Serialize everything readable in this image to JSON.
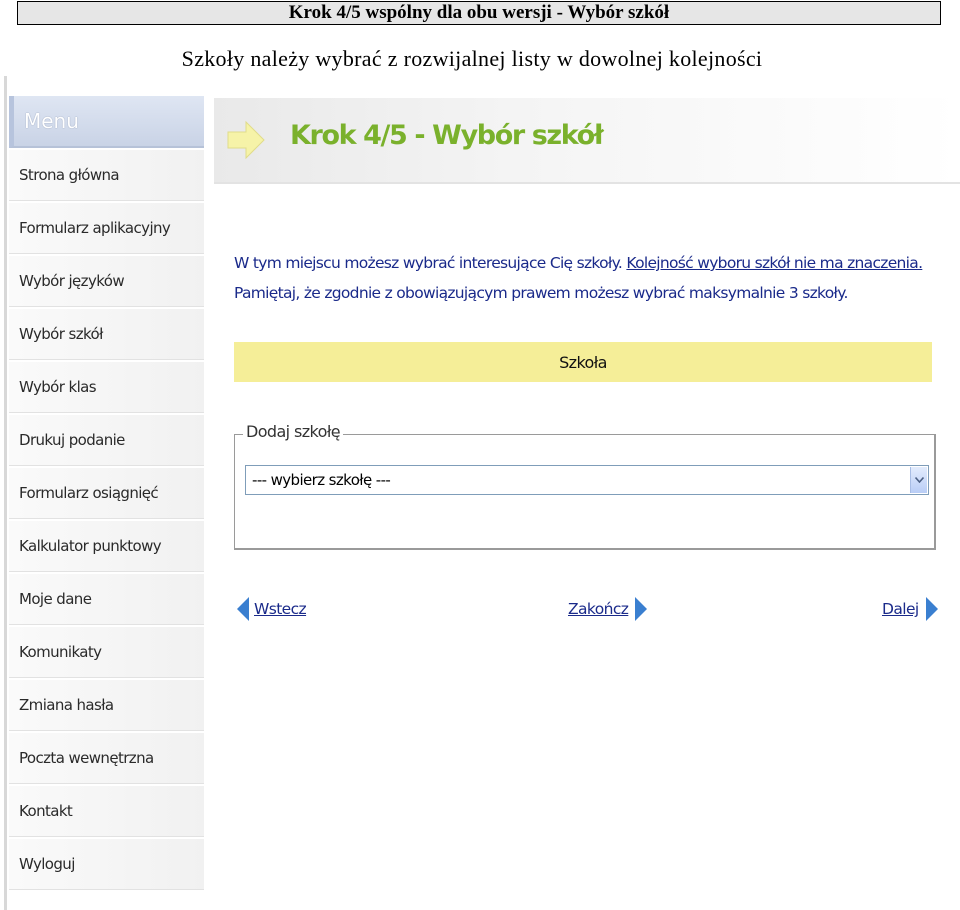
{
  "document": {
    "title": "Krok 4/5 wspólny dla obu wersji - Wybór szkół",
    "subtitle": "Szkoły należy wybrać z rozwijalnej listy w dowolnej kolejności"
  },
  "sidebar": {
    "header": "Menu",
    "items": [
      {
        "label": "Strona główna"
      },
      {
        "label": "Formularz aplikacyjny"
      },
      {
        "label": "Wybór języków"
      },
      {
        "label": "Wybór szkół"
      },
      {
        "label": "Wybór klas"
      },
      {
        "label": "Drukuj podanie"
      },
      {
        "label": "Formularz osiągnięć"
      },
      {
        "label": "Kalkulator punktowy"
      },
      {
        "label": "Moje dane"
      },
      {
        "label": "Komunikaty"
      },
      {
        "label": "Zmiana hasła"
      },
      {
        "label": "Poczta wewnętrzna"
      },
      {
        "label": "Kontakt"
      },
      {
        "label": "Wyloguj"
      }
    ]
  },
  "main": {
    "step_title": "Krok 4/5 - Wybór szkół",
    "info_line1_text": "W tym miejscu możesz wybrać interesujące Cię szkoły.",
    "info_line1_link": "Kolejność wyboru szkół nie ma znaczenia.",
    "info_line2": "Pamiętaj, że zgodnie z obowiązującym prawem możesz wybrać maksymalnie 3 szkoły.",
    "table_header": "Szkoła",
    "fieldset_legend": "Dodaj szkołę",
    "select_value": "--- wybierz szkołę ---",
    "nav": {
      "back": "Wstecz",
      "finish": "Zakończ",
      "next": "Dalej"
    }
  },
  "colors": {
    "title_green": "#7ab12c",
    "link_blue": "#1a2a8a",
    "header_yellow": "#f5ee98",
    "nav_arrow_blue": "#3a7fd0"
  },
  "icons": {
    "banner": "arrow-right-icon",
    "back": "triangle-left-icon",
    "finish": "triangle-right-icon",
    "next": "triangle-right-icon",
    "select": "chevron-down-icon"
  }
}
